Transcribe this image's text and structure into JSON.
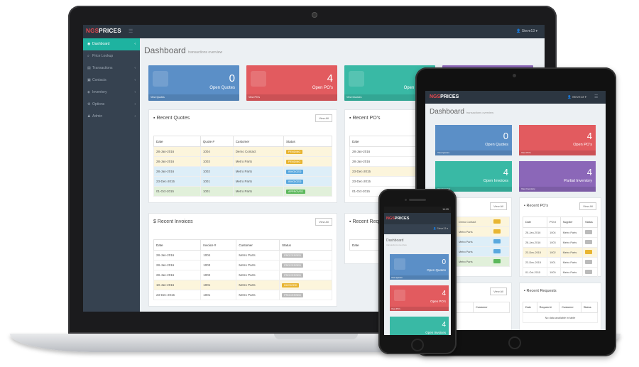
{
  "brand": {
    "a": "NGS",
    "b": "PRICES"
  },
  "user": "Steve13 ▾",
  "sidebar": [
    "Dashboard",
    "Price Lookup",
    "Transactions",
    "Contacts",
    "Inventory",
    "Options",
    "Admin"
  ],
  "page": {
    "title": "Dashboard",
    "subtitle": "transactions overview"
  },
  "stats": [
    {
      "num": "0",
      "label": "Open Quotes",
      "foot": "View Quotes",
      "color": "#5b8fc7"
    },
    {
      "num": "4",
      "label": "Open PO's",
      "foot": "View PO's",
      "color": "#e25b5f"
    },
    {
      "num": "4",
      "label": "Open Invoices",
      "foot": "View Invoices",
      "color": "#39b9a5"
    },
    {
      "num": "4",
      "label": "Partial Inventory",
      "foot": "View Inventory",
      "color": "#8b67b8"
    }
  ],
  "view_all": "View All",
  "quotes": {
    "title": "Recent Quotes",
    "headers": [
      "Date",
      "Quote #",
      "Customer",
      "Status"
    ],
    "rows": [
      {
        "date": "28-Jan-2016",
        "num": "1004",
        "customer": "Demo Contact",
        "status": "PENDING",
        "row": "warn",
        "badge": "b-pending"
      },
      {
        "date": "28-Jan-2016",
        "num": "1003",
        "customer": "Metro Parts",
        "status": "PENDING",
        "row": "warn",
        "badge": "b-pending"
      },
      {
        "date": "28-Jan-2016",
        "num": "1002",
        "customer": "Metro Parts",
        "status": "INVOICED",
        "row": "info",
        "badge": "b-invoiced"
      },
      {
        "date": "23-Dec-2015",
        "num": "1001",
        "customer": "Metro Parts",
        "status": "INVOICED",
        "row": "info",
        "badge": "b-invoiced"
      },
      {
        "date": "01-Oct-2015",
        "num": "1001",
        "customer": "Metro Parts",
        "status": "APPROVED",
        "row": "ok",
        "badge": "b-approved"
      }
    ]
  },
  "pos": {
    "title": "Recent PO's",
    "headers": [
      "Date",
      "PO #",
      "Supplier",
      "Status"
    ],
    "rows": [
      {
        "date": "28-Jan-2016",
        "num": "1004",
        "supplier": "Metro Parts",
        "row": "",
        "badge": "b-processed"
      },
      {
        "date": "28-Jan-2016",
        "num": "1003",
        "supplier": "Metro Parts",
        "row": "",
        "badge": "b-processed"
      },
      {
        "date": "23-Dec-2015",
        "num": "1002",
        "supplier": "Metro Parts",
        "row": "warn",
        "badge": "b-pending"
      },
      {
        "date": "23-Dec-2015",
        "num": "1001",
        "supplier": "Metro Parts",
        "row": "",
        "badge": "b-processed"
      },
      {
        "date": "01-Oct-2015",
        "num": "1000",
        "supplier": "Metro Parts",
        "row": "",
        "badge": "b-processed"
      }
    ]
  },
  "invoices": {
    "title": "Recent Invoices",
    "headers": [
      "Date",
      "Invoice #",
      "Customer",
      "Status"
    ],
    "rows": [
      {
        "date": "28-Jan-2016",
        "num": "1004",
        "customer": "Metro Parts",
        "status": "PROCESSED",
        "row": "",
        "badge": "b-processed"
      },
      {
        "date": "28-Jan-2016",
        "num": "1003",
        "customer": "Metro Parts",
        "status": "PROCESSED",
        "row": "",
        "badge": "b-processed"
      },
      {
        "date": "28-Jan-2016",
        "num": "1002",
        "customer": "Metro Parts",
        "status": "PROCESSED",
        "row": "",
        "badge": "b-processed"
      },
      {
        "date": "10-Jan-2016",
        "num": "1001",
        "customer": "Metro Parts",
        "status": "INVOICED",
        "row": "warn",
        "badge": "b-pending"
      },
      {
        "date": "23-Dec-2015",
        "num": "1001",
        "customer": "Metro Parts",
        "status": "PROCESSED",
        "row": "",
        "badge": "b-processed"
      }
    ]
  },
  "requests": {
    "title": "Recent Requests",
    "headers": [
      "Date",
      "Request #",
      "Customer",
      "Status"
    ],
    "empty": "No data available in table"
  },
  "phone_status": "14:05"
}
